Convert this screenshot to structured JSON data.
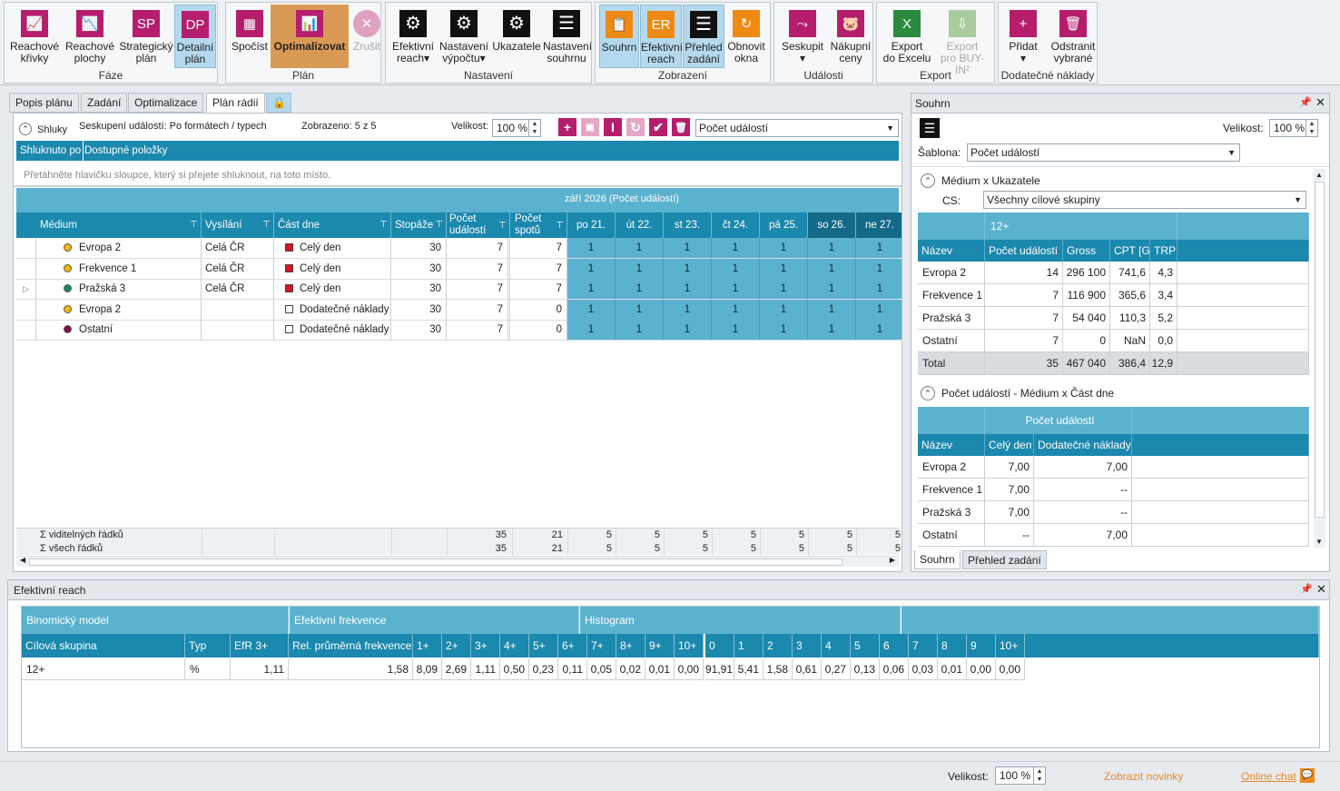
{
  "ribbon": {
    "groups": [
      {
        "caption": "Fáze",
        "buttons": [
          {
            "l1": "Reachové",
            "l2": "křivky",
            "icon": "reach-curves-icon"
          },
          {
            "l1": "Reachové",
            "l2": "plochy",
            "icon": "reach-surfaces-icon"
          },
          {
            "l1": "Strategický",
            "l2": "plán",
            "icon": "SP"
          },
          {
            "l1": "Detailní",
            "l2": "plán",
            "icon": "DP"
          }
        ]
      },
      {
        "caption": "Plán",
        "buttons": [
          {
            "l1": "Spočíst",
            "icon": "calculator-icon"
          },
          {
            "l1": "Optimalizovat",
            "icon": "optimize-icon"
          },
          {
            "l1": "Zrušit",
            "icon": "cancel-icon"
          }
        ]
      },
      {
        "caption": "Nastavení",
        "buttons": [
          {
            "l1": "Efektivní",
            "l2": "reach▾",
            "icon": "gear-icon"
          },
          {
            "l1": "Nastavení",
            "l2": "výpočtu▾",
            "icon": "gear-icon"
          },
          {
            "l1": "Ukazatele",
            "icon": "gear-icon"
          },
          {
            "l1": "Nastavení",
            "l2": "souhrnu",
            "icon": "list-icon"
          }
        ]
      },
      {
        "caption": "Zobrazení",
        "buttons": [
          {
            "l1": "Souhrn",
            "icon": "clipboard-icon"
          },
          {
            "l1": "Efektivní",
            "l2": "reach",
            "icon": "ER"
          },
          {
            "l1": "Přehled",
            "l2": "zadání",
            "icon": "list-icon"
          },
          {
            "l1": "Obnovit",
            "l2": "okna",
            "icon": "refresh-icon"
          }
        ]
      },
      {
        "caption": "Události",
        "buttons": [
          {
            "l1": "Seskupit",
            "l2": "▾",
            "icon": "merge-icon"
          },
          {
            "l1": "Nákupní",
            "l2": "ceny",
            "icon": "piggy-bank-icon"
          }
        ]
      },
      {
        "caption": "Export",
        "buttons": [
          {
            "l1": "Export",
            "l2": "do Excelu",
            "icon": "excel-icon"
          },
          {
            "l1": "Export",
            "l2": "pro BUY-IN²",
            "icon": "export-icon"
          }
        ]
      },
      {
        "caption": "Dodatečné náklady",
        "buttons": [
          {
            "l1": "Přidat",
            "l2": "▾",
            "icon": "plus-icon"
          },
          {
            "l1": "Odstranit",
            "l2": "vybrané",
            "icon": "trash-icon"
          }
        ]
      }
    ]
  },
  "left": {
    "tabs": [
      "Popis plánu",
      "Zadání",
      "Optimalizace",
      "Plán rádií"
    ],
    "toolbar": {
      "shluky": "Shluky",
      "grouping": "Seskupení událostí: Po formátech / typech",
      "shown": "Zobrazeno: 5 z 5",
      "size_label": "Velikost:",
      "size": "100 %",
      "metric": "Počet událostí"
    },
    "group_bar": {
      "a": "Shluknuto po",
      "b": "Dostupné položky"
    },
    "drop_hint": "Přetáhněte hlavičku sloupce, který si přejete shluknout, na toto místo.",
    "period": "září 2026 (Počet událostí)",
    "columns": [
      "Médium",
      "Vysílání",
      "Část dne",
      "Stopáže",
      "Počet událostí",
      "Počet spotů"
    ],
    "days": [
      "po 21.",
      "út 22.",
      "st 23.",
      "čt 24.",
      "pá 25.",
      "so 26.",
      "ne 27."
    ],
    "rows": [
      {
        "medium": "Evropa 2",
        "color": "#f5b800",
        "vys": "Celá ČR",
        "cast": "Celý den",
        "castcolor": "#d9121f",
        "stop": "30",
        "pu": "7",
        "ps": "7",
        "d": [
          "1",
          "1",
          "1",
          "1",
          "1",
          "1",
          "1"
        ]
      },
      {
        "medium": "Frekvence 1",
        "color": "#f5b800",
        "vys": "Celá ČR",
        "cast": "Celý den",
        "castcolor": "#d9121f",
        "stop": "30",
        "pu": "7",
        "ps": "7",
        "d": [
          "1",
          "1",
          "1",
          "1",
          "1",
          "1",
          "1"
        ]
      },
      {
        "medium": "Pražská 3",
        "color": "#168a55",
        "vys": "Celá ČR",
        "cast": "Celý den",
        "castcolor": "#d9121f",
        "stop": "30",
        "pu": "7",
        "ps": "7",
        "d": [
          "1",
          "1",
          "1",
          "1",
          "1",
          "1",
          "1"
        ]
      },
      {
        "medium": "Evropa 2",
        "color": "#f5b800",
        "vys": "",
        "cast": "Dodatečné náklady",
        "castcolor": "#ffffff",
        "stop": "30",
        "pu": "7",
        "ps": "0",
        "d": [
          "1",
          "1",
          "1",
          "1",
          "1",
          "1",
          "1"
        ]
      },
      {
        "medium": "Ostatní",
        "color": "#8a0a5a",
        "vys": "",
        "cast": "Dodatečné náklady",
        "castcolor": "#ffffff",
        "stop": "30",
        "pu": "7",
        "ps": "0",
        "d": [
          "1",
          "1",
          "1",
          "1",
          "1",
          "1",
          "1"
        ]
      }
    ],
    "footer": [
      {
        "label": "Σ viditelných řádků",
        "pu": "35",
        "ps": "21",
        "d": [
          "5",
          "5",
          "5",
          "5",
          "5",
          "5",
          "5"
        ]
      },
      {
        "label": "Σ všech řádků",
        "pu": "35",
        "ps": "21",
        "d": [
          "5",
          "5",
          "5",
          "5",
          "5",
          "5",
          "5"
        ]
      }
    ]
  },
  "souhrn": {
    "title": "Souhrn",
    "size_label": "Velikost:",
    "size": "100 %",
    "sablona_label": "Šablona:",
    "sablona": "Počet událostí",
    "sec1": "Médium x Ukazatele",
    "cs_label": "CS:",
    "cs": "Všechny cílové skupiny",
    "group": "12+",
    "cols1": [
      "Název",
      "Počet událostí",
      "Gross",
      "CPT [G]",
      "TRP"
    ],
    "rows1": [
      [
        "Evropa 2",
        "14",
        "296 100",
        "741,6",
        "4,3"
      ],
      [
        "Frekvence 1",
        "7",
        "116 900",
        "365,6",
        "3,4"
      ],
      [
        "Pražská 3",
        "7",
        "54 040",
        "110,3",
        "5,2"
      ],
      [
        "Ostatní",
        "7",
        "0",
        "NaN",
        "0,0"
      ],
      [
        "Total",
        "35",
        "467 040",
        "386,4",
        "12,9"
      ]
    ],
    "sec2": "Počet událostí - Médium x Část dne",
    "group2": "Počet událostí",
    "cols2": [
      "Název",
      "Celý den",
      "Dodatečné náklady"
    ],
    "rows2": [
      [
        "Evropa 2",
        "7,00",
        "7,00"
      ],
      [
        "Frekvence 1",
        "7,00",
        "--"
      ],
      [
        "Pražská 3",
        "7,00",
        "--"
      ],
      [
        "Ostatní",
        "--",
        "7,00"
      ]
    ],
    "tabs": [
      "Souhrn",
      "Přehled zadání"
    ]
  },
  "er": {
    "title": "Efektivní reach",
    "groups": [
      "Binomický model",
      "Efektivní frekvence",
      "Histogram"
    ],
    "cols": [
      "Cílová skupina",
      "Typ",
      "EfR 3+",
      "Rel. průměrná frekvence"
    ],
    "freq": [
      "1+",
      "2+",
      "3+",
      "4+",
      "5+",
      "6+",
      "7+",
      "8+",
      "9+",
      "10+"
    ],
    "hist": [
      "0",
      "1",
      "2",
      "3",
      "4",
      "5",
      "6",
      "7",
      "8",
      "9",
      "10+"
    ],
    "row": {
      "cs": "12+",
      "typ": "%",
      "efr": "1,11",
      "rel": "1,58",
      "freq": [
        "8,09",
        "2,69",
        "1,11",
        "0,50",
        "0,23",
        "0,11",
        "0,05",
        "0,02",
        "0,01",
        "0,00"
      ],
      "hist": [
        "91,91",
        "5,41",
        "1,58",
        "0,61",
        "0,27",
        "0,13",
        "0,06",
        "0,03",
        "0,01",
        "0,00",
        "0,00"
      ]
    }
  },
  "status": {
    "size_label": "Velikost:",
    "size": "100 %",
    "news": "Zobrazit novinky",
    "chat": "Online chat"
  }
}
